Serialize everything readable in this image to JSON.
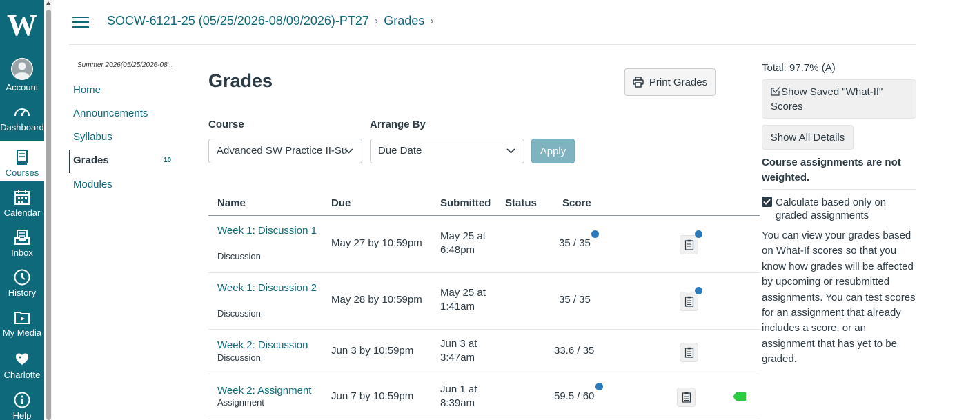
{
  "nav": {
    "logo": "W",
    "items": [
      {
        "label": "Account",
        "icon": "account-avatar-icon"
      },
      {
        "label": "Dashboard",
        "icon": "dashboard-gauge-icon"
      },
      {
        "label": "Courses",
        "icon": "courses-book-icon"
      },
      {
        "label": "Calendar",
        "icon": "calendar-icon"
      },
      {
        "label": "Inbox",
        "icon": "inbox-icon"
      },
      {
        "label": "History",
        "icon": "history-clock-icon"
      },
      {
        "label": "My Media",
        "icon": "media-folder-icon"
      },
      {
        "label": "Charlotte",
        "icon": "charlotte-bird-icon"
      },
      {
        "label": "Help",
        "icon": "help-info-icon"
      }
    ],
    "active": "Courses",
    "color": "#0e6a7a"
  },
  "breadcrumb": {
    "course": "SOCW-6121-25 (05/25/2026-08/09/2026)-PT27",
    "page": "Grades",
    "separator": "›"
  },
  "course_nav": {
    "term": "Summer 2026(05/25/2026-08...",
    "items": [
      {
        "label": "Home"
      },
      {
        "label": "Announcements"
      },
      {
        "label": "Syllabus"
      },
      {
        "label": "Grades",
        "badge": "10"
      },
      {
        "label": "Modules"
      }
    ],
    "active": "Grades"
  },
  "main": {
    "title": "Grades",
    "print_label": "Print Grades",
    "course_label": "Course",
    "course_value": "Advanced SW Practice II-Su",
    "arrange_label": "Arrange By",
    "arrange_value": "Due Date",
    "apply_label": "Apply"
  },
  "table": {
    "headers": {
      "name": "Name",
      "due": "Due",
      "submitted": "Submitted",
      "status": "Status",
      "score": "Score"
    },
    "rows": [
      {
        "name": "Week 1: Discussion 1",
        "type": "Discussion",
        "due": "May 27 by 10:59pm",
        "submitted": "May 25 at 6:48pm",
        "status": "",
        "score": "35 / 35",
        "score_dot": true,
        "rubric_dot": true,
        "flag": false
      },
      {
        "name": "Week 1: Discussion 2",
        "type": "Discussion",
        "due": "May 28 by 10:59pm",
        "submitted": "May 25 at 1:41am",
        "status": "",
        "score": "35 / 35",
        "score_dot": false,
        "rubric_dot": true,
        "flag": false
      },
      {
        "name": "Week 2: Discussion",
        "type": "Discussion",
        "due": "Jun 3 by 10:59pm",
        "submitted": "Jun 3 at 3:47am",
        "status": "",
        "score": "33.6 / 35",
        "score_dot": false,
        "rubric_dot": false,
        "flag": false
      },
      {
        "name": "Week 2: Assignment",
        "type": "Assignment",
        "due": "Jun 7 by 10:59pm",
        "submitted": "Jun 1 at 8:39am",
        "status": "",
        "score": "59.5 / 60",
        "score_dot": true,
        "rubric_dot": false,
        "flag": true
      }
    ],
    "dot_color": "#2b7abc",
    "flag_color": "#2ecc40"
  },
  "sidebar": {
    "total": "Total: 97.7% (A)",
    "whatif_label": "Show Saved \"What-If\" Scores",
    "details_label": "Show All Details",
    "weighted_text": "Course assignments are not weighted.",
    "checkbox_label": "Calculate based only on graded assignments",
    "checkbox_checked": true,
    "info_text": "You can view your grades based on What-If scores so that you know how grades will be affected by upcoming or resubmitted assignments. You can test scores for an assignment that already includes a score, or an assignment that has yet to be graded."
  }
}
